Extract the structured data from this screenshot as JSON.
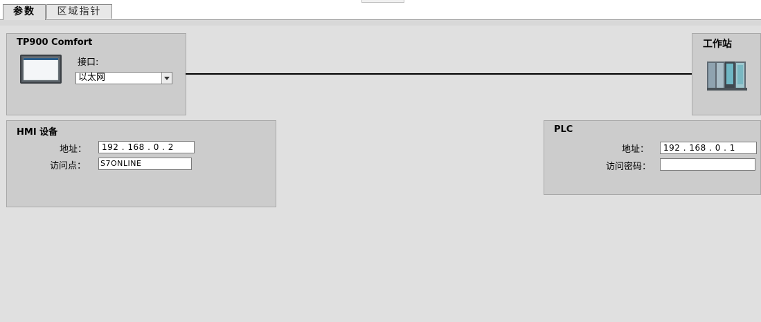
{
  "tabs": [
    {
      "label": "参数",
      "active": true
    },
    {
      "label": "区域指针",
      "active": false
    }
  ],
  "hmi_device": {
    "title": "TP900 Comfort",
    "interface_label": "接口:",
    "interface_value": "以太网",
    "icon": "hmi-panel-icon"
  },
  "workstation": {
    "title": "工作站",
    "icon": "plc-station-icon"
  },
  "hmi_settings": {
    "title": "HMI 设备",
    "address_label": "地址：",
    "address_value": "192 . 168 . 0    . 2",
    "access_point_label": "访问点：",
    "access_point_value": "S7ONLINE"
  },
  "plc_settings": {
    "title": "PLC",
    "address_label": "地址：",
    "address_value": "192 . 168 . 0    . 1",
    "password_label": "访问密码：",
    "password_value": ""
  },
  "colors": {
    "background": "#e0e0e0",
    "panel": "#cccccc",
    "connector": "#000000"
  }
}
